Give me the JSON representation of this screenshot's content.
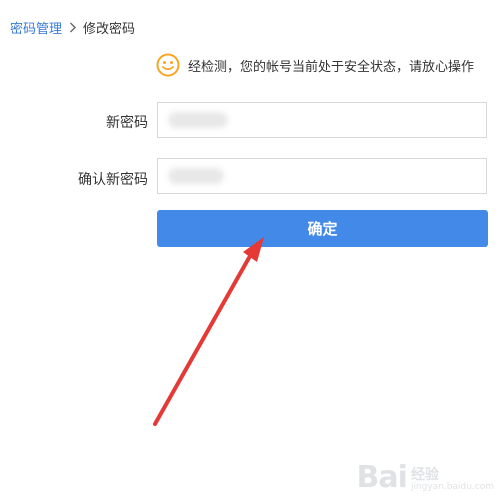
{
  "breadcrumb": {
    "parent": "密码管理",
    "current": "修改密码"
  },
  "notice": {
    "icon": "smile-icon",
    "text": "经检测，您的帐号当前处于安全状态，请放心操作"
  },
  "form": {
    "new_password_label": "新密码",
    "confirm_password_label": "确认新密码",
    "new_password_value": "",
    "confirm_password_value": ""
  },
  "confirm_button_label": "确定",
  "watermark": {
    "logo": "Bai",
    "brand": "经验",
    "url": "jingyan.baidu.com"
  },
  "colors": {
    "link": "#3a7bd5",
    "button": "#4289e8",
    "icon": "#f5a623",
    "arrow": "#e53935"
  }
}
